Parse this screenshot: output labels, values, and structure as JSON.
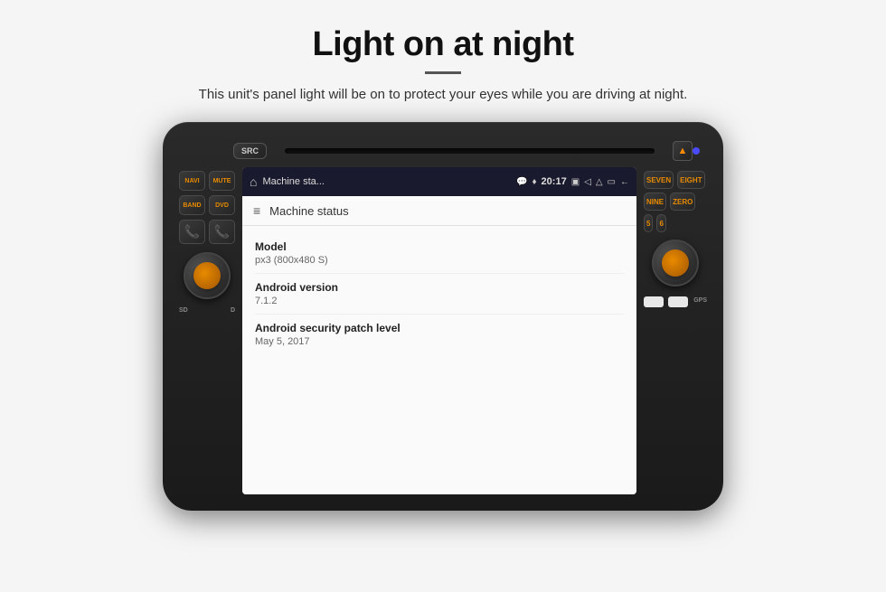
{
  "page": {
    "title": "Light on at night",
    "divider": true,
    "subtitle": "This unit's panel light will be on to protect your eyes while you are driving at night."
  },
  "device": {
    "src_label": "SRC",
    "navi_label": "NAVI",
    "mute_label": "MUTE",
    "band_label": "BAND",
    "dvd_label": "DVD",
    "seven_label": "SEVEN",
    "eight_label": "EIGHT",
    "nine_label": "NINE",
    "zero_label": "ZERO",
    "sd_label": "SD",
    "d_label": "D",
    "gps_label": "GPS"
  },
  "statusbar": {
    "home_icon": "⌂",
    "title": "Machine sta...",
    "chat_icon": "💬",
    "pin_icon": "♦",
    "time": "20:17",
    "photo_icon": "▣",
    "vol_icon": "◁",
    "eject_icon": "△",
    "cast_icon": "▭",
    "arrow_icon": "↩",
    "back_icon": "←"
  },
  "app": {
    "header_title": "Machine status",
    "items": [
      {
        "label": "Model",
        "value": "px3 (800x480 S)"
      },
      {
        "label": "Android version",
        "value": "7.1.2"
      },
      {
        "label": "Android security patch level",
        "value": "May 5, 2017"
      }
    ]
  }
}
